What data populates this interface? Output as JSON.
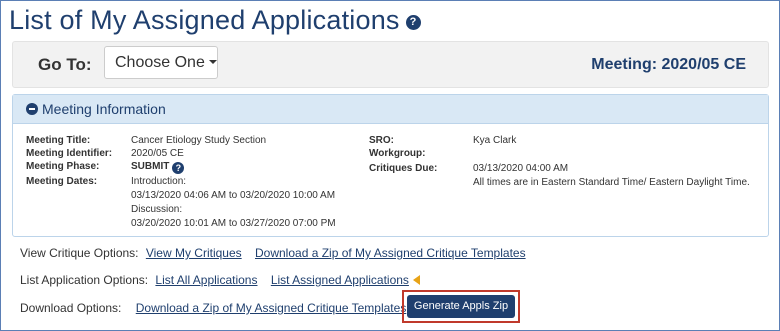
{
  "page": {
    "title": "List of My Assigned Applications"
  },
  "goto": {
    "label": "Go To:",
    "select_value": "Choose One",
    "meeting_label": "Meeting: 2020/05 CE"
  },
  "panel": {
    "title": "Meeting Information",
    "left": [
      {
        "label": "Meeting Title:",
        "value": "Cancer Etiology Study Section"
      },
      {
        "label": "Meeting Identifier:",
        "value": "2020/05 CE"
      },
      {
        "label": "Meeting Phase:",
        "value": "SUBMIT"
      },
      {
        "label": "Meeting Dates:",
        "value": "Introduction:"
      }
    ],
    "dates": [
      "03/13/2020 04:06 AM  to  03/20/2020 10:00 AM",
      "Discussion:",
      "03/20/2020 10:01 AM  to  03/27/2020 07:00 PM"
    ],
    "right": [
      {
        "label": "SRO:",
        "value": "Kya Clark"
      },
      {
        "label": "Workgroup:",
        "value": ""
      },
      {
        "label": "Critiques Due:",
        "value": "03/13/2020 04:00 AM"
      }
    ],
    "timezone_note": "All times are in Eastern Standard Time/ Eastern Daylight Time."
  },
  "options": {
    "critique_label": "View Critique Options:",
    "critique_links": [
      "View My Critiques",
      "Download a Zip of My Assigned Critique Templates"
    ],
    "list_label": "List Application Options:",
    "list_links": [
      "List All Applications",
      "List Assigned Applications"
    ],
    "download_label": "Download Options:",
    "download_links": [
      "Download a Zip of My Assigned Critique Templates"
    ],
    "generate_button": "Generate Appls Zip"
  },
  "icons": {
    "help": "question-circle-icon",
    "collapse": "minus-circle-icon",
    "current": "caret-left-icon",
    "accent": "#e8a317",
    "brand": "#1f3f6e",
    "highlight": "#c0392b"
  }
}
